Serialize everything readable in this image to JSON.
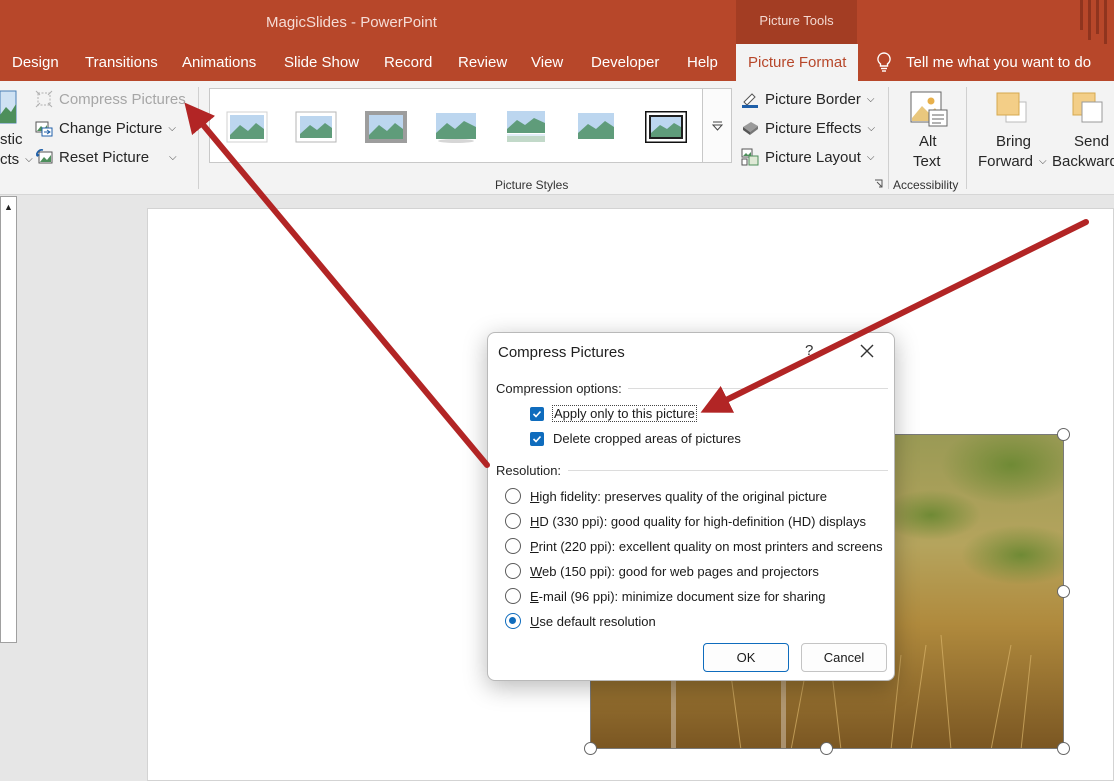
{
  "window": {
    "app_title": "MagicSlides  -  PowerPoint",
    "context_tab_group": "Picture Tools"
  },
  "tabs": [
    {
      "label": "Design"
    },
    {
      "label": "Transitions"
    },
    {
      "label": "Animations"
    },
    {
      "label": "Slide Show"
    },
    {
      "label": "Record"
    },
    {
      "label": "Review"
    },
    {
      "label": "View"
    },
    {
      "label": "Developer"
    },
    {
      "label": "Help"
    },
    {
      "label": "Picture Format",
      "active": true
    }
  ],
  "tell_me": "Tell me what you want to do",
  "ribbon": {
    "artistic_partial_1": "stic",
    "artistic_partial_2": "cts",
    "compress_pictures": "Compress Pictures",
    "change_picture": "Change Picture",
    "reset_picture": "Reset Picture",
    "picture_styles_label": "Picture Styles",
    "picture_border": "Picture Border",
    "picture_effects": "Picture Effects",
    "picture_layout": "Picture Layout",
    "alt_text_1": "Alt",
    "alt_text_2": "Text",
    "accessibility_label": "Accessibility",
    "bring_forward_1": "Bring",
    "bring_forward_2": "Forward",
    "send_backward_1": "Send",
    "send_backward_2": "Backward"
  },
  "dialog": {
    "title": "Compress Pictures",
    "help": "?",
    "compression_heading": "Compression options:",
    "apply_only": {
      "label": "Apply only to this picture",
      "checked": true
    },
    "delete_cropped": {
      "label": "Delete cropped areas of pictures",
      "checked": true
    },
    "resolution_heading": "Resolution:",
    "resolutions": [
      {
        "key": "H",
        "rest": "igh fidelity: preserves quality of the original picture",
        "selected": false
      },
      {
        "key": "H",
        "rest": "D (330 ppi): good quality for high-definition (HD) displays",
        "selected": false
      },
      {
        "key": "P",
        "rest": "rint (220 ppi): excellent quality on most printers and screens",
        "selected": false
      },
      {
        "key": "W",
        "rest": "eb (150 ppi): good for web pages and projectors",
        "selected": false
      },
      {
        "key": "E",
        "rest": "-mail (96 ppi): minimize document size for sharing",
        "selected": false
      },
      {
        "key": "U",
        "rest": "se default resolution",
        "selected": true
      }
    ],
    "ok": "OK",
    "cancel": "Cancel"
  },
  "colors": {
    "brand": "#b7472a",
    "accent": "#0f6cbd",
    "annotation_arrow": "#b22525"
  }
}
